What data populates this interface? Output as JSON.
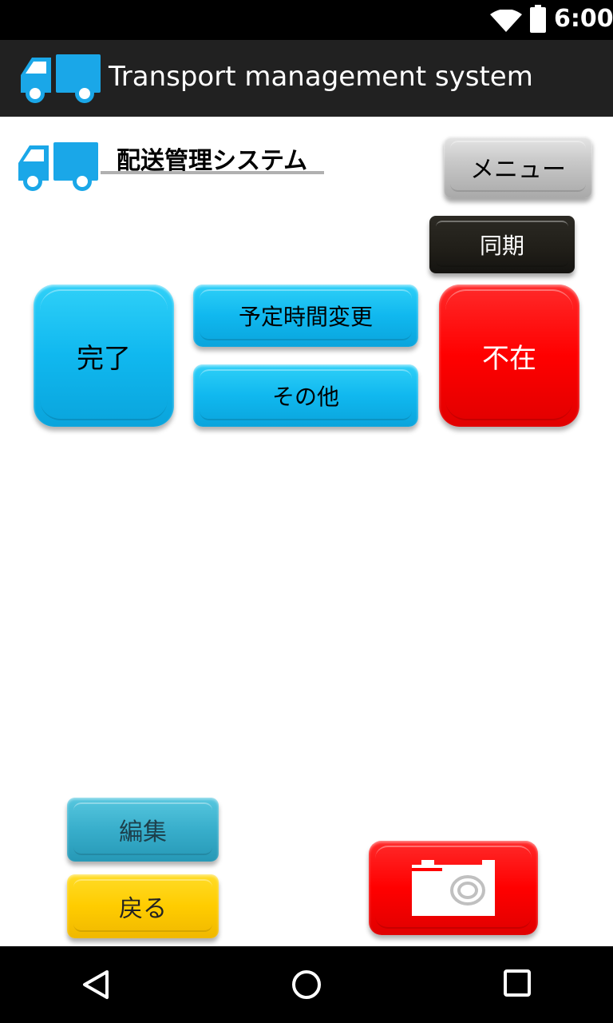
{
  "status_bar": {
    "time": "6:00",
    "icons": [
      "wifi-icon",
      "battery-icon"
    ]
  },
  "app_bar": {
    "title": "Transport management system",
    "icon": "truck-icon"
  },
  "header": {
    "title": "配送管理システム",
    "logo": "truck-icon"
  },
  "buttons": {
    "menu": "メニュー",
    "sync": "同期",
    "complete": "完了",
    "reschedule": "予定時間変更",
    "other": "その他",
    "absent": "不在",
    "edit": "編集",
    "back": "戻る",
    "camera": "camera-icon"
  },
  "nav_bar": {
    "icons": [
      "back-icon",
      "home-icon",
      "recents-icon"
    ]
  },
  "colors": {
    "blue_button": "#10b8ef",
    "red_button": "#ff0000",
    "yellow_button": "#ffcc00",
    "edit_button": "#38aecb",
    "dark_button": "#201e18",
    "gray_button": "#c9c9c9",
    "action_bar": "#212121",
    "truck_blue": "#1aa7e8"
  }
}
